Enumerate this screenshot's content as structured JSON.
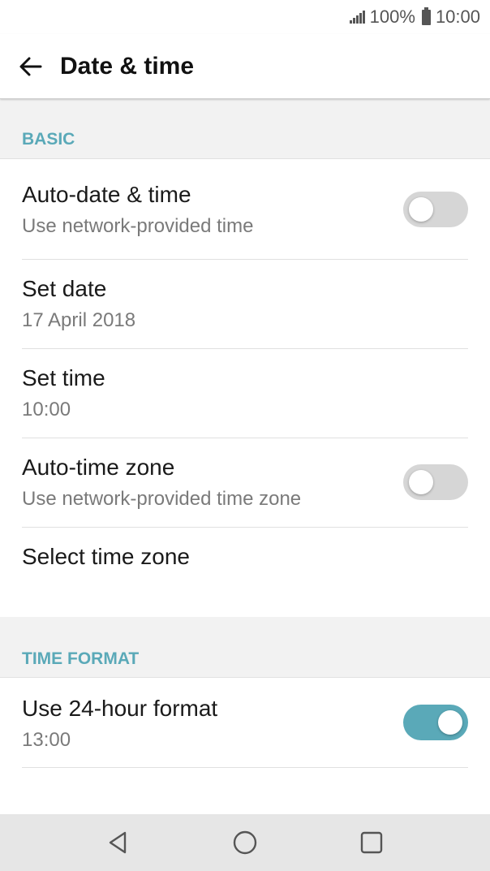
{
  "status_bar": {
    "battery_text": "100%",
    "time": "10:00",
    "icons": [
      "signal-icon",
      "battery-icon"
    ]
  },
  "app_bar": {
    "title": "Date & time",
    "back_icon": "arrow-left-icon"
  },
  "sections": {
    "basic": {
      "header": "BASIC",
      "auto_date": {
        "title": "Auto-date & time",
        "subtitle": "Use network-provided time",
        "enabled": false
      },
      "set_date": {
        "title": "Set date",
        "subtitle": "17 April 2018"
      },
      "set_time": {
        "title": "Set time",
        "subtitle": "10:00"
      },
      "auto_zone": {
        "title": "Auto-time zone",
        "subtitle": "Use network-provided time zone",
        "enabled": false
      },
      "select_zone": {
        "title": "Select time zone"
      }
    },
    "time_format": {
      "header": "TIME FORMAT",
      "use_24h": {
        "title": "Use 24-hour format",
        "subtitle": "13:00",
        "enabled": true
      }
    }
  },
  "colors": {
    "accent": "#5aa9b8",
    "toggle_off": "#d6d6d6",
    "section_bg": "#f2f2f2",
    "nav_bg": "#e6e6e6"
  },
  "nav_bar": {
    "buttons": [
      "back-triangle-icon",
      "home-circle-icon",
      "recents-square-icon"
    ]
  }
}
